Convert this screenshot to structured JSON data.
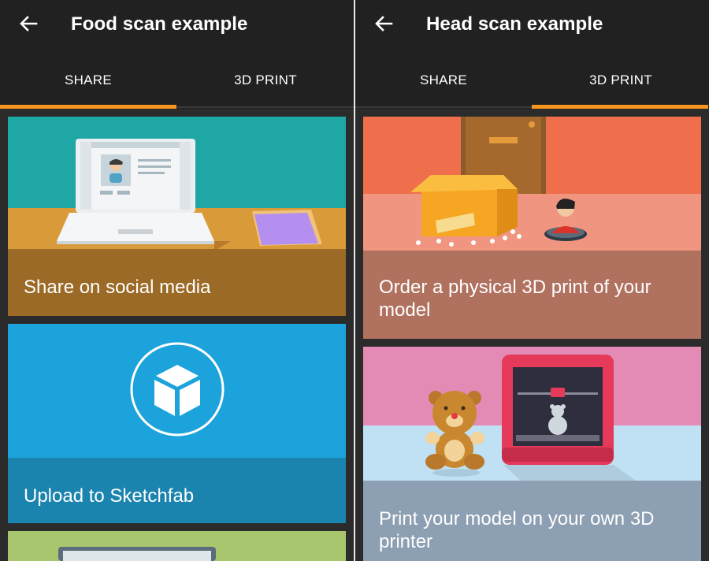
{
  "left_panel": {
    "title": "Food scan example",
    "tabs": [
      {
        "label": "SHARE",
        "selected": true
      },
      {
        "label": "3D PRINT",
        "selected": false
      }
    ],
    "cards": [
      {
        "label": "Share on social media"
      },
      {
        "label": "Upload to Sketchfab"
      }
    ]
  },
  "right_panel": {
    "title": "Head scan example",
    "tabs": [
      {
        "label": "SHARE",
        "selected": false
      },
      {
        "label": "3D PRINT",
        "selected": true
      }
    ],
    "cards": [
      {
        "label": "Order a physical 3D print of your model"
      },
      {
        "label": "Print your model on your own 3D printer"
      }
    ]
  },
  "colors": {
    "appbar": "#212121",
    "accent": "#f7941d",
    "social_card_top": "#1ea7a5",
    "social_card_caption": "#9b6a26",
    "sketchfab_card": "#1da3dc",
    "sketchfab_caption": "#1a84ae",
    "order_card": "#ef6f4d",
    "order_caption": "#b0715f",
    "printer_card": "#e38ab5",
    "printer_caption": "#8d9fb2"
  },
  "icons": {
    "back": "arrow-left-icon",
    "sketchfab": "sketchfab-cube-icon"
  }
}
